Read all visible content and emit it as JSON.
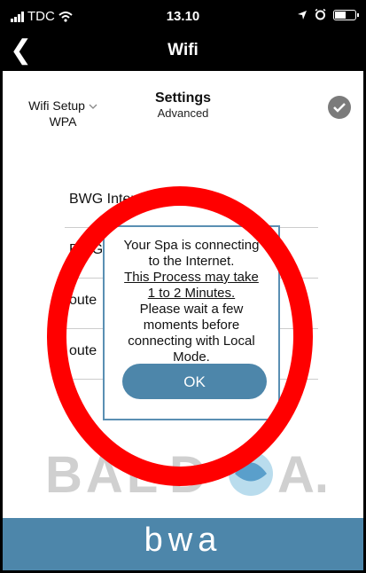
{
  "status": {
    "carrier": "TDC",
    "time": "13.10",
    "battery_level": 0.55
  },
  "nav": {
    "back_symbol": "❮",
    "title": "Wifi"
  },
  "setup": {
    "wifi_setup_label": "Wifi Setup",
    "wifi_mode": "WPA",
    "settings_title": "Settings",
    "settings_sub": "Advanced"
  },
  "networks": [
    {
      "label": "BWG Intern"
    },
    {
      "label": "BWG"
    },
    {
      "label": "oute"
    },
    {
      "label": "oute"
    }
  ],
  "dialog": {
    "line1": "Your Spa is connecting",
    "line2": "to the Internet.",
    "line3": "This Process may take",
    "line4": "1 to 2 Minutes.",
    "line5": "Please wait a few",
    "line6": "moments before",
    "line7": "connecting with Local",
    "line8": "Mode.",
    "ok_label": "OK"
  },
  "logo": {
    "text": "BAL A."
  },
  "footer": {
    "brand": "bwa"
  },
  "colors": {
    "accent": "#4d86aa",
    "annotation_red": "#ff0000",
    "check_gray": "#7b7b7b"
  },
  "icons": {
    "signal": "signal-bars-icon",
    "wifi": "wifi-icon",
    "location": "location-arrow-icon",
    "alarm": "alarm-icon",
    "battery": "battery-icon",
    "back": "chevron-left-icon",
    "check": "checkmark-circle-icon",
    "dropdown": "chevron-down-icon"
  }
}
